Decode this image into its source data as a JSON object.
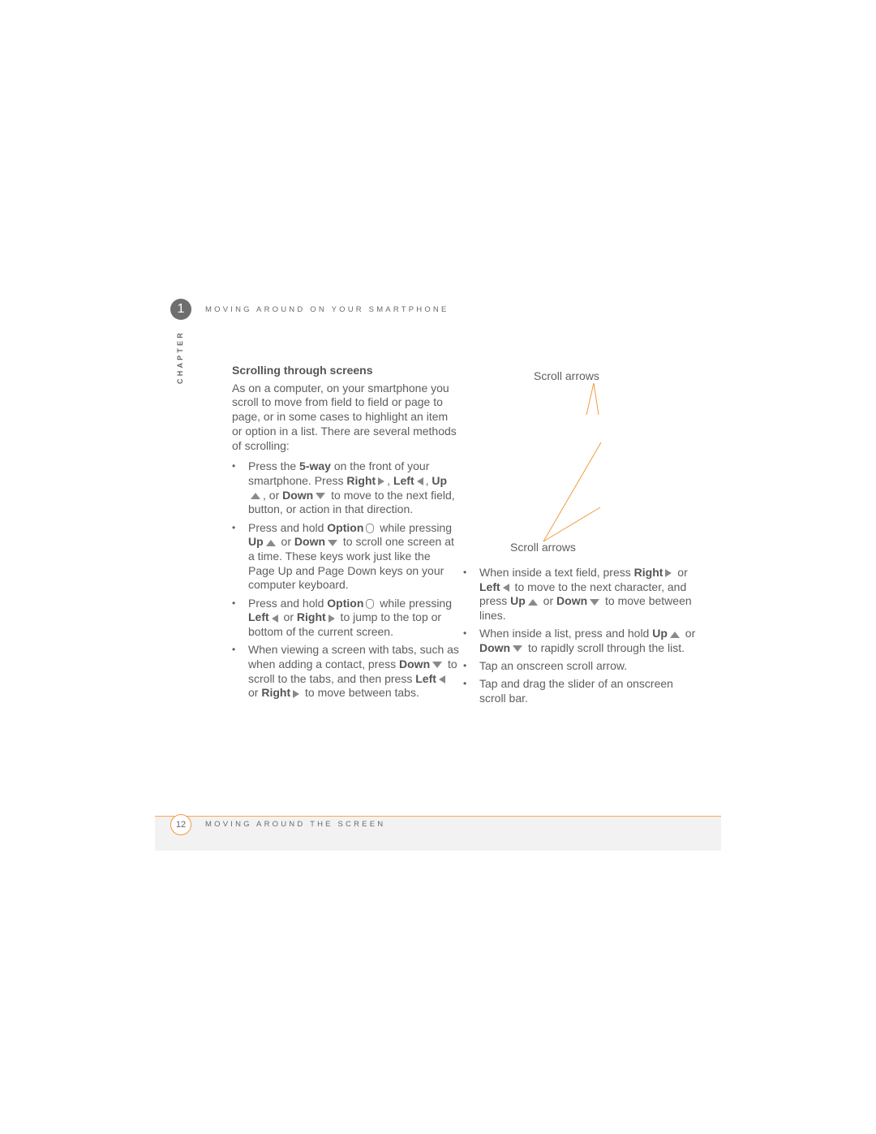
{
  "header": {
    "chapter_number": "1",
    "chapter_label": "CHAPTER",
    "chapter_title": "MOVING AROUND ON YOUR SMARTPHONE"
  },
  "section": {
    "heading": "Scrolling through screens",
    "intro": "As on a computer, on your smartphone you scroll to move from field to field or page to page, or in some cases to highlight an item or option in a list. There are several methods of scrolling:"
  },
  "keys": {
    "five_way": "5-way",
    "right": "Right",
    "left": "Left",
    "up": "Up",
    "down": "Down",
    "option": "Option"
  },
  "bullets_left": {
    "b1": {
      "t1": "Press the ",
      "t2": " on the front of your smartphone. Press ",
      "t3": ", ",
      "t4": ",",
      "t5": ", or ",
      "t6": " to move to the next field, button, or action in that direction."
    },
    "b2": {
      "t1": "Press and hold ",
      "t2": " while pressing ",
      "t3": " or ",
      "t4": " to scroll one screen at a time. These keys work just like the Page Up and Page Down keys on your computer keyboard."
    },
    "b3": {
      "t1": "Press and hold ",
      "t2": " while pressing ",
      "t3": " or ",
      "t4": " to jump to the top or bottom of the current screen."
    },
    "b4": {
      "t1": "When viewing a screen with tabs, such as when adding a contact, press ",
      "t2": " to scroll to the tabs, and then press ",
      "t3": " or ",
      "t4": " to move between tabs."
    }
  },
  "callouts": {
    "top": "Scroll arrows",
    "bottom": "Scroll arrows",
    "line_color": "#f29a3f"
  },
  "bullets_right": {
    "b1": {
      "t1": "When inside a text field, press ",
      "t2": " or ",
      "t3": " to move to the next character, and press ",
      "t4": " or ",
      "t5": " to move between lines."
    },
    "b2": {
      "t1": "When inside a list, press and hold ",
      "t2": " or ",
      "t3": " to rapidly scroll through the list."
    },
    "b3": "Tap an onscreen scroll arrow.",
    "b4": "Tap and drag the slider of an onscreen scroll bar."
  },
  "footer": {
    "page_number": "12",
    "section_title": "MOVING AROUND THE SCREEN",
    "accent_color": "#f29a3f"
  }
}
